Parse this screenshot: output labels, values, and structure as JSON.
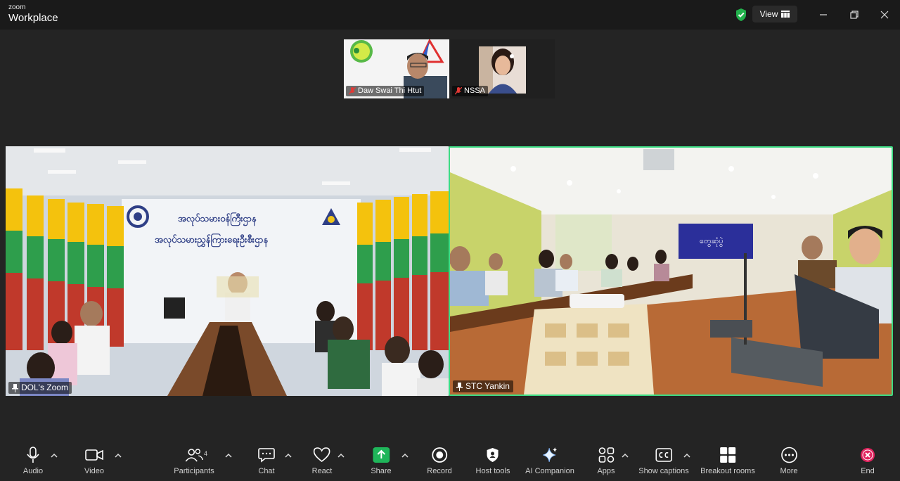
{
  "app": {
    "brand_top": "zoom",
    "brand_bottom": "Workplace",
    "view_label": "View"
  },
  "thumbnails": [
    {
      "name": "Daw Swai Thi Htut",
      "muted": true
    },
    {
      "name": "NSSA",
      "muted": true
    }
  ],
  "videos": [
    {
      "name": "DOL's Zoom",
      "pinned": true,
      "banner_line1": "အလုပ်သမားဝန်ကြီးဌာန",
      "banner_line2": "အလုပ်သမားညွှန်ကြားရေးဦးစီးဌာန"
    },
    {
      "name": "STC Yankin",
      "pinned": true,
      "active_speaker": true,
      "banner": "တွေဆုံပွဲ"
    }
  ],
  "toolbar": {
    "audio": "Audio",
    "video": "Video",
    "participants": "Participants",
    "participants_count": "4",
    "chat": "Chat",
    "react": "React",
    "share": "Share",
    "record": "Record",
    "host_tools": "Host tools",
    "ai_companion": "AI Companion",
    "apps": "Apps",
    "captions": "Show captions",
    "breakout": "Breakout rooms",
    "more": "More",
    "end": "End"
  },
  "colors": {
    "background": "#242424",
    "titlebar": "#1a1a1a",
    "active_border": "#3ddc84",
    "share_green": "#1fb65a",
    "end_red": "#e0245e"
  },
  "icons": [
    "shield-check-icon",
    "view-grid-icon",
    "minimize-icon",
    "restore-icon",
    "close-icon",
    "mic-icon",
    "camera-icon",
    "participants-icon",
    "chat-icon",
    "heart-icon",
    "share-arrow-icon",
    "record-icon",
    "shield-icon",
    "sparkle-icon",
    "apps-icon",
    "cc-icon",
    "grid-icon",
    "more-icon",
    "end-x-icon",
    "pin-icon",
    "mic-muted-icon",
    "caret-up-icon"
  ]
}
